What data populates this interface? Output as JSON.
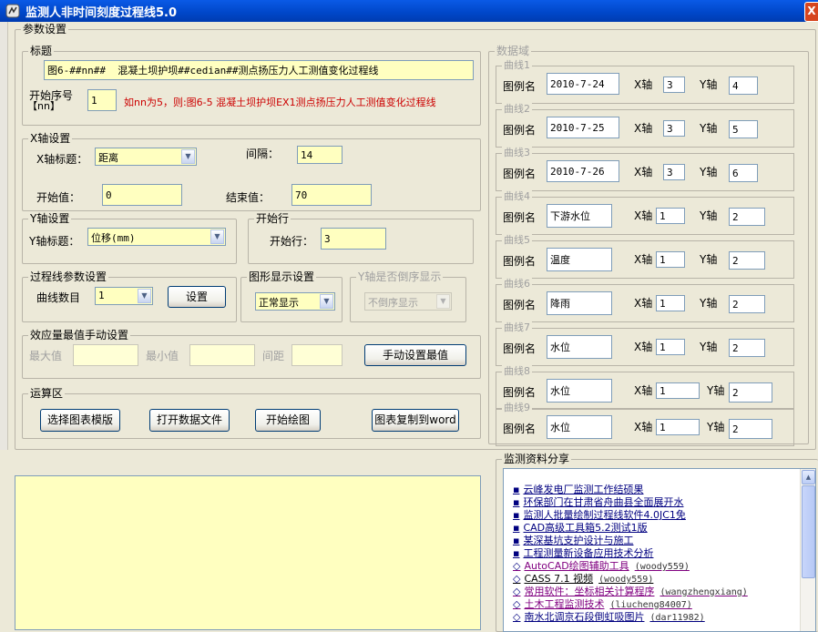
{
  "window": {
    "title": "监测人非时间刻度过程线5.0",
    "close_label": "X"
  },
  "params_group": "参数设置",
  "title_section": {
    "legend": "标题",
    "title_value": "图6-##nn##  混凝土坝护坝##cedian##测点扬压力人工测值变化过程线",
    "start_no_label": "开始序号",
    "start_no_sub": "【nn】",
    "start_no_value": "1",
    "hint": "如nn为5，则:图6-5   混凝土坝护坝EX1测点扬压力人工测值变化过程线"
  },
  "xaxis": {
    "legend": "X轴设置",
    "title_label": "X轴标题：",
    "title_value": "距离",
    "interval_label": "间隔：",
    "interval_value": "14",
    "start_label": "开始值：",
    "start_value": "0",
    "end_label": "结束值：",
    "end_value": "70"
  },
  "yaxis": {
    "legend": "Y轴设置",
    "title_label": "Y轴标题：",
    "title_value": "位移(mm)"
  },
  "start_row": {
    "legend": "开始行",
    "label": "开始行：",
    "value": "3"
  },
  "curve_params": {
    "legend": "过程线参数设置",
    "count_label": "曲线数目",
    "count_value": "1",
    "setup_button": "设置"
  },
  "display": {
    "legend": "图形显示设置",
    "value": "正常显示"
  },
  "yreverse": {
    "legend": "Y轴是否倒序显示",
    "value": "不倒序显示"
  },
  "extreme": {
    "legend": "效应量最值手动设置",
    "max_label": "最大值",
    "min_label": "最小值",
    "spacing_label": "间距",
    "manual_button": "手动设置最值"
  },
  "ops": {
    "legend": "运算区",
    "select_template": "选择图表模版",
    "open_data": "打开数据文件",
    "start_draw": "开始绘图",
    "copy_word": "图表复制到word"
  },
  "data_domain": {
    "legend": "数据域",
    "name_label": "图例名",
    "x_label": "X轴",
    "y_label": "Y轴",
    "curves": [
      {
        "legend": "曲线1",
        "name": "2010-7-24",
        "x": "3",
        "y": "4"
      },
      {
        "legend": "曲线2",
        "name": "2010-7-25",
        "x": "3",
        "y": "5"
      },
      {
        "legend": "曲线3",
        "name": "2010-7-26",
        "x": "3",
        "y": "6"
      },
      {
        "legend": "曲线4",
        "name": "下游水位",
        "x": "1",
        "y": "2"
      },
      {
        "legend": "曲线5",
        "name": "温度",
        "x": "1",
        "y": "2"
      },
      {
        "legend": "曲线6",
        "name": "降雨",
        "x": "1",
        "y": "2"
      },
      {
        "legend": "曲线7",
        "name": "水位",
        "x": "1",
        "y": "2"
      },
      {
        "legend": "曲线8",
        "name": "水位",
        "x": "1",
        "y": "2"
      },
      {
        "legend": "曲线9",
        "name": "水位",
        "x": "1",
        "y": "2"
      }
    ]
  },
  "share": {
    "legend": "监测资料分享",
    "links": [
      {
        "bullet": "▪",
        "text": "云峰发电厂监测工作结硕果",
        "author": "",
        "color": "#000080"
      },
      {
        "bullet": "▪",
        "text": "环保部门在甘肃省舟曲县全面展开水",
        "author": "",
        "color": "#000080"
      },
      {
        "bullet": "▪",
        "text": "监测人批量绘制过程线软件4.0JC1免",
        "author": "",
        "color": "#000080"
      },
      {
        "bullet": "▪",
        "text": "CAD高级工具箱5.2测试1版",
        "author": "",
        "color": "#000080"
      },
      {
        "bullet": "▪",
        "text": "某深基坑支护设计与施工",
        "author": "",
        "color": "#000080"
      },
      {
        "bullet": "▪",
        "text": "工程测量新设备应用技术分析",
        "author": "",
        "color": "#000080"
      },
      {
        "bullet": "◇",
        "text": "AutoCAD绘图辅助工具",
        "author": "(woody559)",
        "color": "#800080"
      },
      {
        "bullet": "◇",
        "text": "CASS 7.1 视频",
        "author": "(woody559)",
        "color": "#000000"
      },
      {
        "bullet": "◇",
        "text": "常用软件：坐标相关计算程序",
        "author": "(wangzhengxiang)",
        "color": "#800080"
      },
      {
        "bullet": "◇",
        "text": "土木工程监测技术",
        "author": "(liucheng84007)",
        "color": "#800080"
      },
      {
        "bullet": "◇",
        "text": "南水北调京石段倒虹吸图片",
        "author": "(dar11982)",
        "color": "#000080"
      }
    ]
  },
  "colors": {
    "titlebar": "#0054e3",
    "input_bg": "#ffffc0",
    "panel_bg": "#ece9d8",
    "hint_red": "#cc0000"
  }
}
